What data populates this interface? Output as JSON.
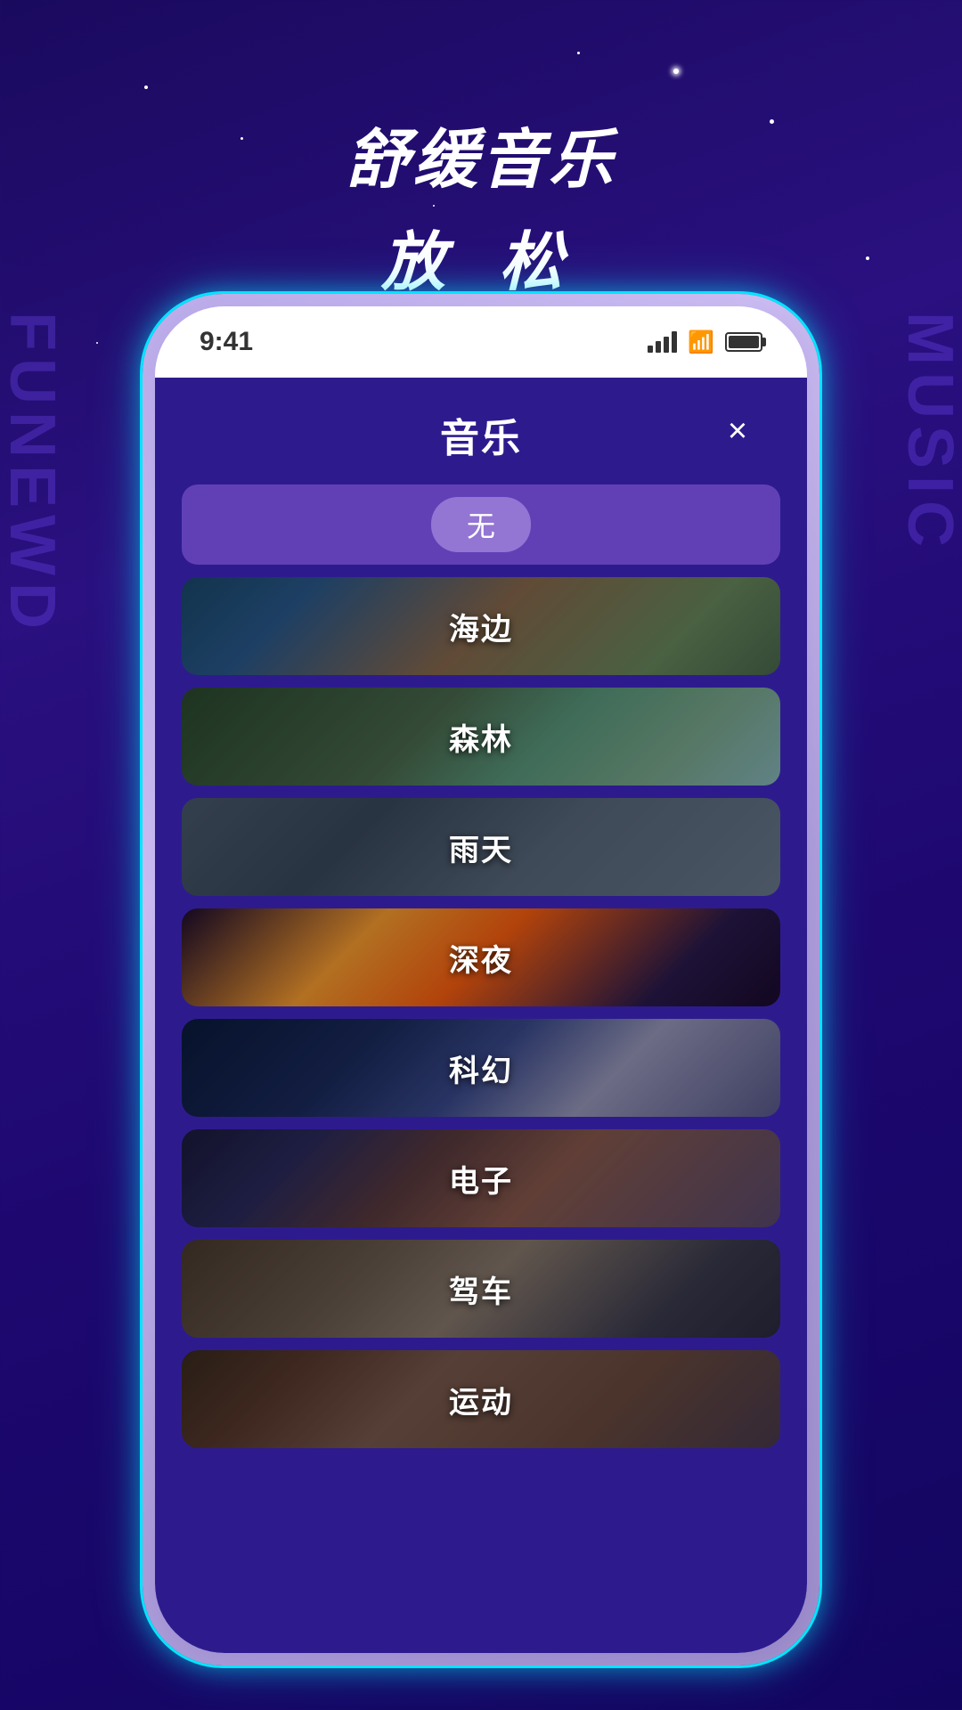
{
  "background": {
    "sideTextLeft": "FUNEWD",
    "sideTextRight": "MUSIC"
  },
  "header": {
    "line1": "舒缓音乐",
    "line2": "放 松"
  },
  "statusBar": {
    "time": "9:41",
    "icons": [
      "signal",
      "wifi",
      "battery"
    ]
  },
  "app": {
    "title": "音乐",
    "closeLabel": "×"
  },
  "musicItems": [
    {
      "id": "none",
      "label": "无",
      "type": "none"
    },
    {
      "id": "beach",
      "label": "海边",
      "type": "item",
      "bg": "beach"
    },
    {
      "id": "forest",
      "label": "森林",
      "type": "item",
      "bg": "forest"
    },
    {
      "id": "rain",
      "label": "雨天",
      "type": "item",
      "bg": "rain"
    },
    {
      "id": "night",
      "label": "深夜",
      "type": "item",
      "bg": "night"
    },
    {
      "id": "scifi",
      "label": "科幻",
      "type": "item",
      "bg": "scifi"
    },
    {
      "id": "electronic",
      "label": "电子",
      "type": "item",
      "bg": "electronic"
    },
    {
      "id": "driving",
      "label": "驾车",
      "type": "item",
      "bg": "driving"
    },
    {
      "id": "sports",
      "label": "运动",
      "type": "item",
      "bg": "sports"
    }
  ]
}
